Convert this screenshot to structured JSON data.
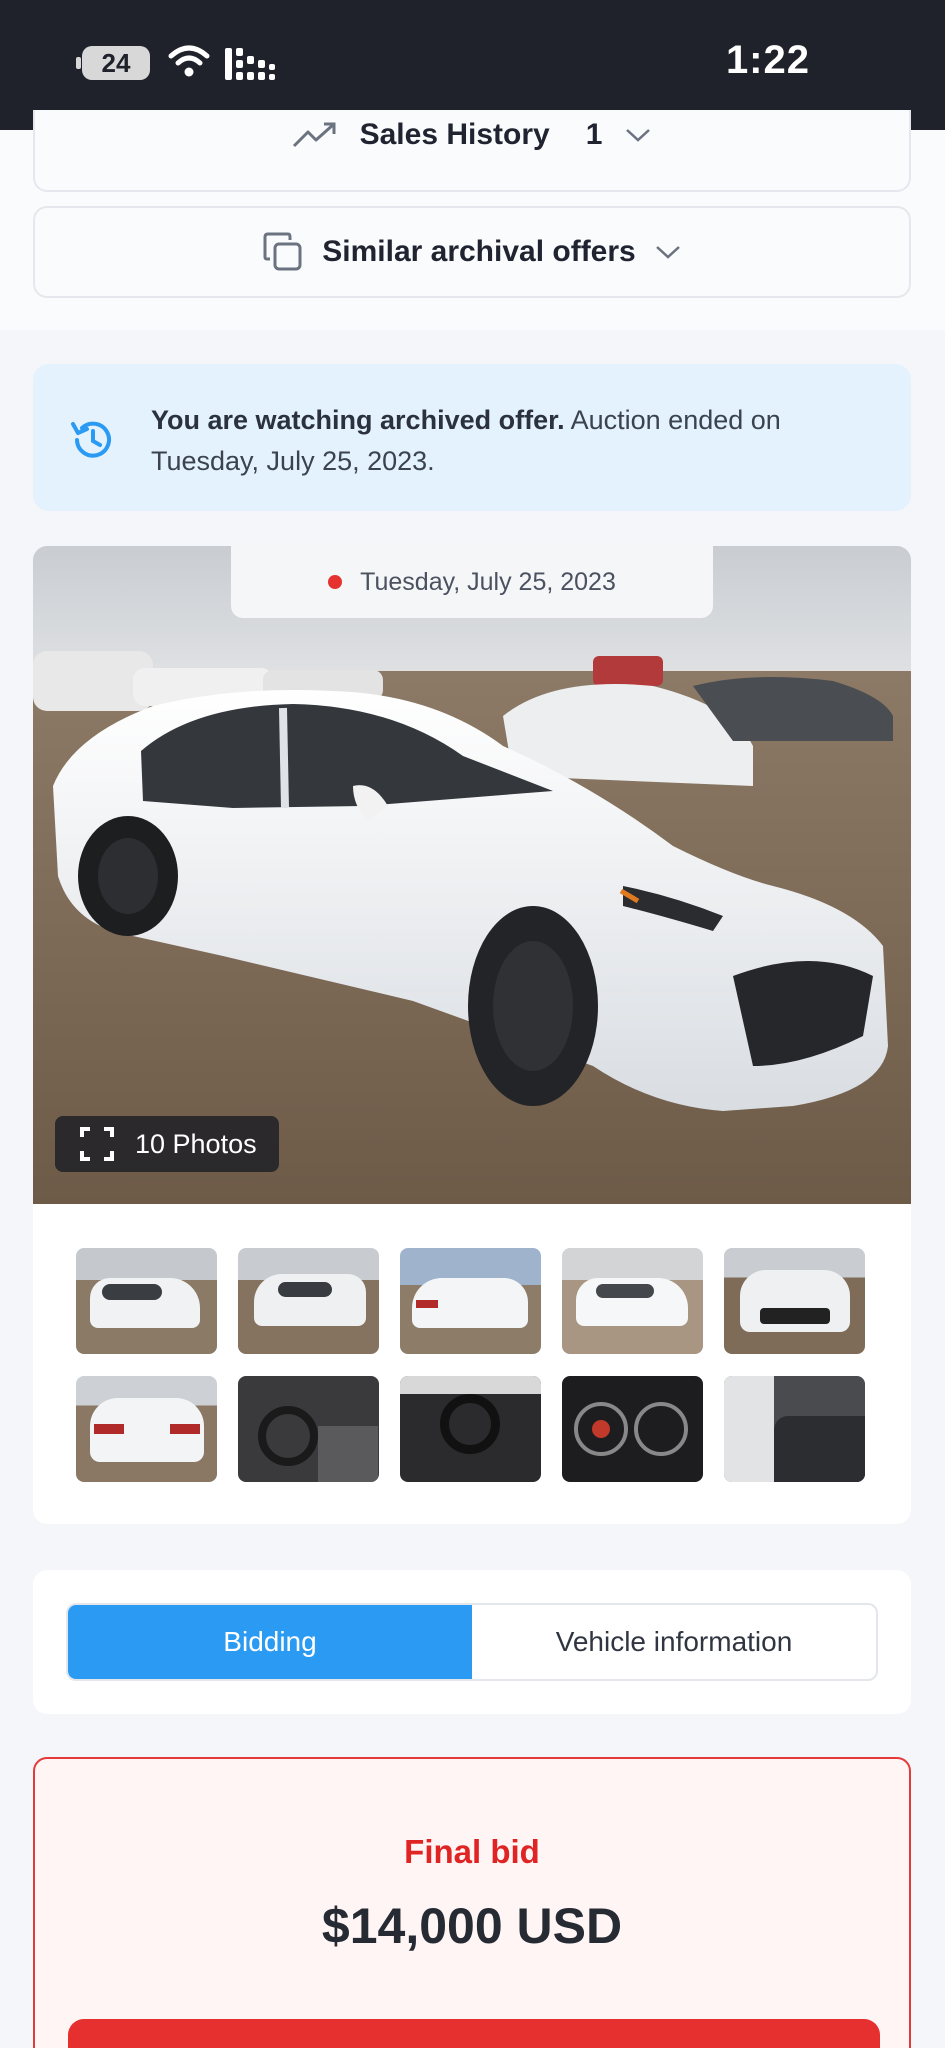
{
  "status_bar": {
    "battery": "24",
    "time": "1:22"
  },
  "accordions": {
    "sales_history": {
      "label": "Sales History",
      "count": "1"
    },
    "similar": {
      "label": "Similar archival offers"
    }
  },
  "banner": {
    "bold": "You are watching archived offer.",
    "rest": " Auction ended on Tuesday, July 25, 2023."
  },
  "gallery": {
    "date": "Tuesday, July 25, 2023",
    "photos_label": "10 Photos",
    "thumbnails": [
      "front-left damage",
      "rear-left damage",
      "rear-right",
      "front-right",
      "front",
      "rear",
      "interior dashboard",
      "steering wheel",
      "gauge cluster",
      "rear seats"
    ]
  },
  "tabs": {
    "bidding": "Bidding",
    "vehicle_info": "Vehicle information"
  },
  "bid": {
    "label": "Final bid",
    "value": "$14,000 USD"
  },
  "colors": {
    "accent": "#2b9af3",
    "danger": "#e02424",
    "banner_bg": "#e3f2fd"
  }
}
